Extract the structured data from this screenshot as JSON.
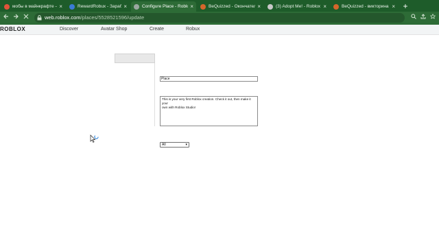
{
  "tabs": [
    {
      "title": "мобы в майнкрафте —",
      "favicon_color": "#e0533a",
      "active": false
    },
    {
      "title": "RewardRobux - Зарабо",
      "favicon_color": "#3a7bd5",
      "active": false
    },
    {
      "title": "Configure Place - Roblox",
      "favicon_color": "#9aa7a0",
      "active": true
    },
    {
      "title": "BeQuizzed - Окончател",
      "favicon_color": "#d4662b",
      "active": false
    },
    {
      "title": "(3) Adopt Me! - Roblox",
      "favicon_color": "#c8c8c8",
      "active": false
    },
    {
      "title": "BeQuizzed - викторина",
      "favicon_color": "#d4662b",
      "active": false
    }
  ],
  "tab_close_glyph": "×",
  "new_tab_glyph": "+",
  "toolbar": {
    "back_icon": "back-arrow-icon",
    "forward_icon": "forward-arrow-icon",
    "stop_icon": "close-icon",
    "url_host": "web.roblox.com",
    "url_path": "/places/5528521596/update"
  },
  "nav": {
    "logo": "ROBLOX",
    "links": [
      "Discover",
      "Avatar Shop",
      "Create",
      "Robux"
    ]
  },
  "form": {
    "name_value": "Place",
    "description_value": "This is your very first Roblox creation. Check it out, then make it your\nown with Roblox Studio!",
    "genre_value": "All"
  },
  "colors": {
    "browser_frame": "#1e5c2a",
    "active_tab": "#2d6b36",
    "nav_background": "#f2f4f5"
  }
}
